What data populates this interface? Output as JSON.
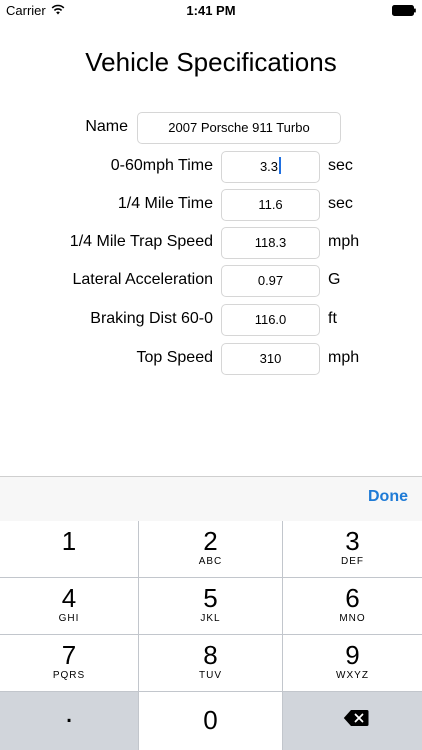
{
  "status_bar": {
    "carrier": "Carrier",
    "time": "1:41 PM"
  },
  "title": "Vehicle Specifications",
  "form": {
    "name": {
      "label": "Name",
      "value": "2007 Porsche 911 Turbo"
    },
    "rows": [
      {
        "label": "0-60mph Time",
        "value": "3.3",
        "unit": "sec"
      },
      {
        "label": "1/4 Mile Time",
        "value": "11.6",
        "unit": "sec"
      },
      {
        "label": "1/4 Mile Trap Speed",
        "value": "118.3",
        "unit": "mph"
      },
      {
        "label": "Lateral Acceleration",
        "value": "0.97",
        "unit": "G"
      },
      {
        "label": "Braking Dist 60-0",
        "value": "116.0",
        "unit": "ft"
      },
      {
        "label": "Top Speed",
        "value": "310",
        "unit": "mph"
      }
    ]
  },
  "accessory": {
    "done_label": "Done"
  },
  "keypad": {
    "keys": [
      {
        "digit": "1",
        "letters": ""
      },
      {
        "digit": "2",
        "letters": "ABC"
      },
      {
        "digit": "3",
        "letters": "DEF"
      },
      {
        "digit": "4",
        "letters": "GHI"
      },
      {
        "digit": "5",
        "letters": "JKL"
      },
      {
        "digit": "6",
        "letters": "MNO"
      },
      {
        "digit": "7",
        "letters": "PQRS"
      },
      {
        "digit": "8",
        "letters": "TUV"
      },
      {
        "digit": "9",
        "letters": "WXYZ"
      }
    ],
    "decimal": ".",
    "zero": "0",
    "delete_icon": "backspace-icon"
  },
  "colors": {
    "accent": "#1f7bd6",
    "keypad_bg": "#c2c6cc",
    "key_light": "#ffffff",
    "key_dark": "#d1d5db"
  }
}
